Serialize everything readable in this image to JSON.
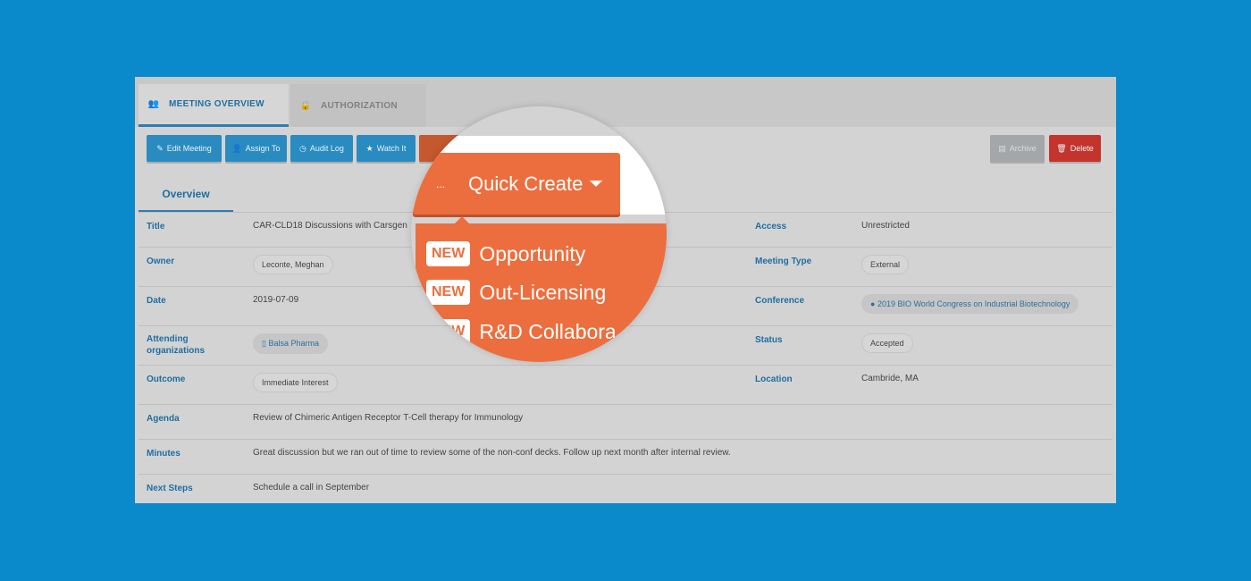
{
  "tabs": [
    {
      "label": "MEETING OVERVIEW",
      "icon": "users-icon",
      "active": true
    },
    {
      "label": "AUTHORIZATION",
      "icon": "lock-icon",
      "active": false
    }
  ],
  "toolbar": {
    "edit": "Edit Meeting",
    "assign": "Assign To",
    "audit": "Audit Log",
    "watch": "Watch It",
    "more": "...",
    "archive": "Archive",
    "delete": "Delete"
  },
  "subtab": "Overview",
  "fields": {
    "title": {
      "label": "Title",
      "value": "CAR-CLD18 Discussions with Carsgen"
    },
    "owner": {
      "label": "Owner",
      "value": "Leconte, Meghan"
    },
    "date": {
      "label": "Date",
      "value": "2019-07-09"
    },
    "attending": {
      "label": "Attending organizations",
      "value": "Balsa Pharma"
    },
    "outcome": {
      "label": "Outcome",
      "value": "Immediate Interest"
    },
    "agenda": {
      "label": "Agenda",
      "value": "Review of Chimeric Antigen Receptor T-Cell therapy for Immunology"
    },
    "minutes": {
      "label": "Minutes",
      "value": "Great discussion but we ran out of time to review some of the non-conf decks. Follow up next month after internal review."
    },
    "next_steps": {
      "label": "Next Steps",
      "value": "Schedule a call in September"
    },
    "access": {
      "label": "Access",
      "value": "Unrestricted"
    },
    "meeting_type": {
      "label": "Meeting Type",
      "value": "External"
    },
    "conference": {
      "label": "Conference",
      "value": "2019 BIO World Congress on Industrial Biotechnology"
    },
    "status": {
      "label": "Status",
      "value": "Accepted"
    },
    "location": {
      "label": "Location",
      "value": "Cambride, MA"
    }
  },
  "quick_create": {
    "dots": "...",
    "label": "Quick Create",
    "badge": "NEW",
    "items": [
      "Opportunity",
      "Out-Licensing",
      "R&D Collabora"
    ]
  },
  "colors": {
    "background": "#0a89cb",
    "primary": "#2a8bc0",
    "accent": "#ec6e3e",
    "danger": "#c4342c"
  }
}
